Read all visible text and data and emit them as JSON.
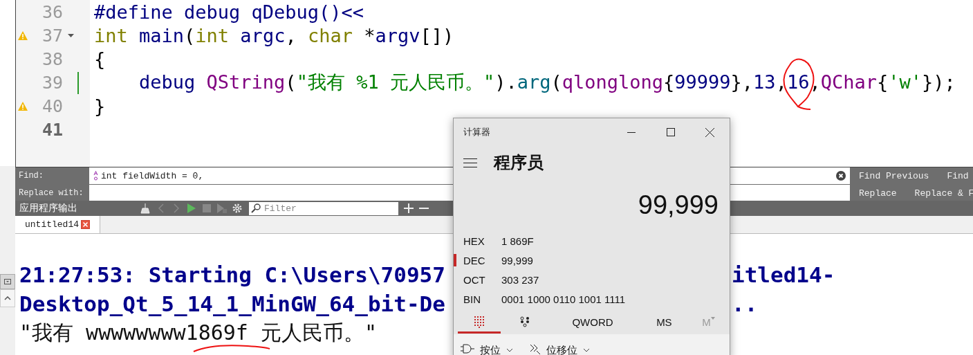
{
  "editor": {
    "lines": [
      {
        "number": "36",
        "warning": false,
        "fold": false,
        "current": false,
        "modified": false,
        "tokens": [
          {
            "kind": "macro",
            "text": "#define debug qDebug()<<"
          }
        ]
      },
      {
        "number": "37",
        "warning": true,
        "fold": true,
        "current": false,
        "modified": false,
        "tokens": [
          {
            "kind": "keyword",
            "text": "int"
          },
          {
            "kind": "ident",
            "text": " main"
          },
          {
            "kind": "plain",
            "text": "("
          },
          {
            "kind": "keyword",
            "text": "int"
          },
          {
            "kind": "ident",
            "text": " argc"
          },
          {
            "kind": "plain",
            "text": ", "
          },
          {
            "kind": "keyword",
            "text": "char"
          },
          {
            "kind": "plain",
            "text": " *"
          },
          {
            "kind": "ident",
            "text": "argv"
          },
          {
            "kind": "plain",
            "text": "[])"
          }
        ]
      },
      {
        "number": "38",
        "warning": false,
        "fold": false,
        "current": false,
        "modified": false,
        "tokens": [
          {
            "kind": "plain",
            "text": "{"
          }
        ]
      },
      {
        "number": "39",
        "warning": false,
        "fold": false,
        "current": false,
        "modified": true,
        "tokens": [
          {
            "kind": "ident",
            "text": "    debug"
          },
          {
            "kind": "type",
            "text": " QString"
          },
          {
            "kind": "plain",
            "text": "("
          },
          {
            "kind": "string",
            "text": "\"我有 %1 元人民币。\""
          },
          {
            "kind": "plain",
            "text": ")."
          },
          {
            "kind": "func",
            "text": "arg"
          },
          {
            "kind": "plain",
            "text": "("
          },
          {
            "kind": "type",
            "text": "qlonglong"
          },
          {
            "kind": "plain",
            "text": "{"
          },
          {
            "kind": "number",
            "text": "99999"
          },
          {
            "kind": "plain",
            "text": "},"
          },
          {
            "kind": "number",
            "text": "13"
          },
          {
            "kind": "plain",
            "text": ","
          },
          {
            "kind": "number",
            "text": "16"
          },
          {
            "kind": "plain",
            "text": ","
          },
          {
            "kind": "type",
            "text": "QChar"
          },
          {
            "kind": "plain",
            "text": "{"
          },
          {
            "kind": "string",
            "text": "'w'"
          },
          {
            "kind": "plain",
            "text": "});"
          }
        ]
      },
      {
        "number": "40",
        "warning": true,
        "fold": false,
        "current": false,
        "modified": false,
        "tokens": [
          {
            "kind": "plain",
            "text": "}"
          }
        ]
      },
      {
        "number": "41",
        "warning": false,
        "fold": false,
        "current": true,
        "modified": false
      }
    ]
  },
  "find_bar": {
    "find_label": "Find:",
    "find_value": "int fieldWidth = 0,",
    "replace_label": "Replace with:",
    "find_buttons": [
      "Find Previous",
      "Find"
    ],
    "replace_buttons": [
      "Replace",
      "Replace & F"
    ]
  },
  "output_pane": {
    "title": "应用程序输出",
    "filter_placeholder": "Filter",
    "tabs": [
      {
        "label": "untitled14",
        "selected": true
      }
    ],
    "lines": [
      {
        "kind": "status",
        "segments": [
          "21:27:53: Starting C:\\Users\\70957",
          "itled14-"
        ]
      },
      {
        "kind": "status",
        "segments": [
          "Desktop_Qt_5_14_1_MinGW_64_bit-De",
          ".."
        ]
      },
      {
        "kind": "output",
        "segments": [
          "\"我有 wwwwwwww1869f 元人民币。\""
        ]
      }
    ]
  },
  "calculator": {
    "title": "计算器",
    "mode": "程序员",
    "display": "99,999",
    "radixes": [
      {
        "label": "HEX",
        "value": "1 869F",
        "selected": false
      },
      {
        "label": "DEC",
        "value": "99,999",
        "selected": true
      },
      {
        "label": "OCT",
        "value": "303 237",
        "selected": false
      },
      {
        "label": "BIN",
        "value": "0001 1000 0110 1001 1111",
        "selected": false
      }
    ],
    "tabs": [
      {
        "kind": "keypad",
        "selected": true,
        "disabled": false
      },
      {
        "kind": "bits",
        "selected": false,
        "disabled": false
      },
      {
        "kind": "text",
        "label": "QWORD",
        "selected": false,
        "disabled": false
      },
      {
        "kind": "text",
        "label": "MS",
        "selected": false,
        "disabled": false
      },
      {
        "kind": "menu",
        "label": "M",
        "selected": false,
        "disabled": true
      }
    ],
    "operations": [
      {
        "kind": "bitwise",
        "label": "按位"
      },
      {
        "kind": "shift",
        "label": "位移位"
      }
    ]
  }
}
